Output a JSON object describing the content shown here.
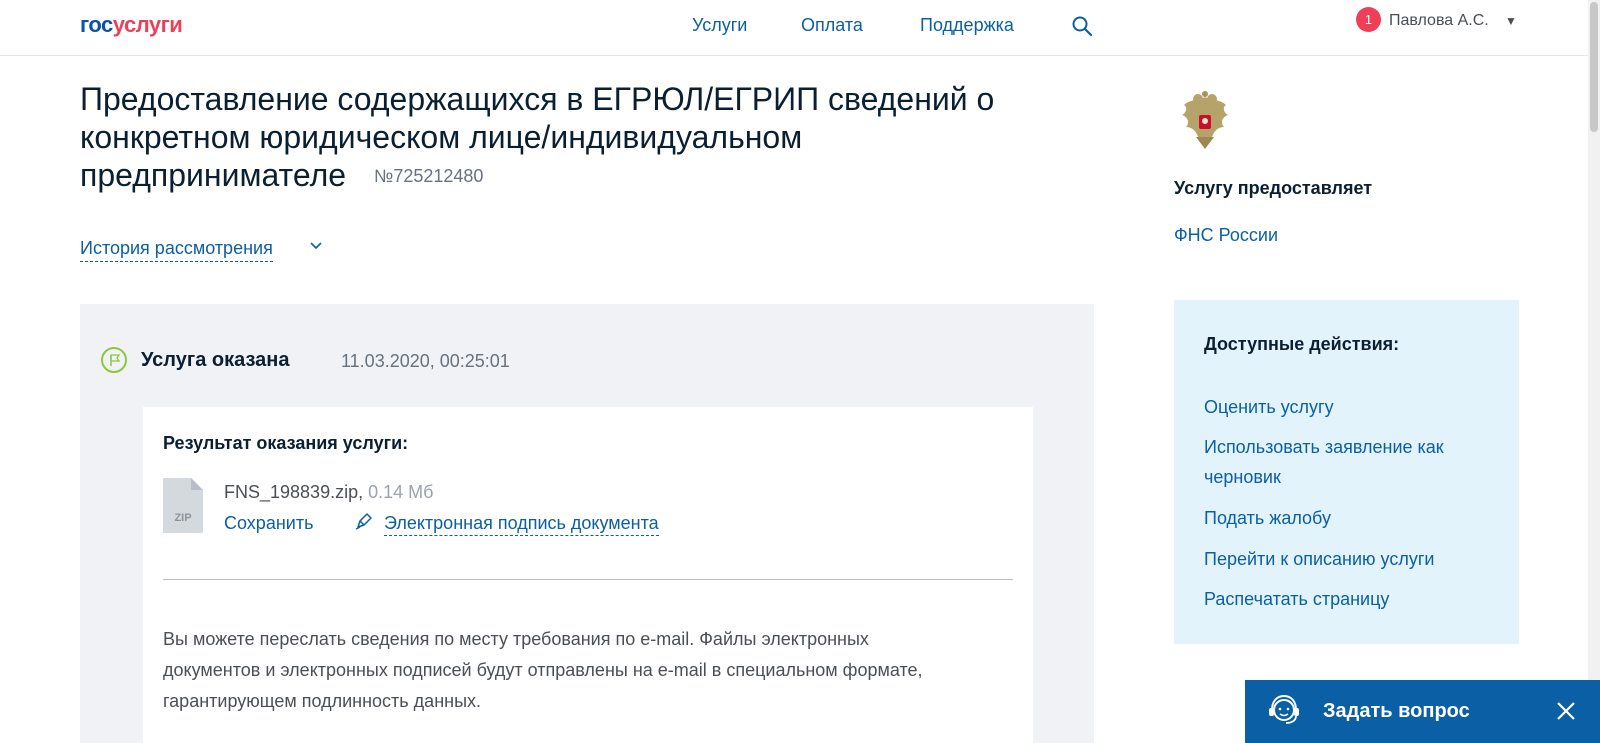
{
  "header": {
    "logo_part1": "гос",
    "logo_part2": "услуги",
    "nav": [
      "Услуги",
      "Оплата",
      "Поддержка"
    ],
    "notification_count": "1",
    "user_name": "Павлова А.С."
  },
  "page": {
    "title": "Предоставление содержащихся в ЕГРЮЛ/ЕГРИП сведений о конкретном юридическом лице/индивидуальном предпринимателе",
    "order_number": "№725212480",
    "history_link": "История рассмотрения"
  },
  "status": {
    "title": "Услуга оказана",
    "datetime": "11.03.2020, 00:25:01"
  },
  "result": {
    "title": "Результат оказания услуги:",
    "file_type": "ZIP",
    "file_name": "FNS_198839.zip,",
    "file_size": "0.14 Мб",
    "save_label": "Сохранить",
    "sign_label": "Электронная подпись документа",
    "info_text": "Вы можете переслать сведения по месту требования по e-mail. Файлы электронных документов и электронных подписей будут отправлены на e-mail в специальном формате, гарантирующем подлинность данных."
  },
  "provider": {
    "label": "Услугу предоставляет",
    "name": "ФНС России"
  },
  "actions": {
    "title": "Доступные действия:",
    "items": [
      "Оценить услугу",
      "Использовать заявление как черновик",
      "Подать жалобу",
      "Перейти к описанию услуги",
      "Распечатать страницу"
    ]
  },
  "chat": {
    "label": "Задать вопрос"
  },
  "colors": {
    "link": "#0b5fa5",
    "brand_red": "#ee3f58",
    "brand_blue": "#0b52a8",
    "status_green": "#8dc63f",
    "actions_bg": "#e3f3fb",
    "card_bg": "#f0f2f5"
  },
  "icons": [
    "search-icon",
    "chevron-down-icon",
    "flag-icon",
    "zip-file-icon",
    "signature-icon",
    "emblem-icon",
    "support-agent-icon",
    "close-icon",
    "caret-down-icon"
  ]
}
